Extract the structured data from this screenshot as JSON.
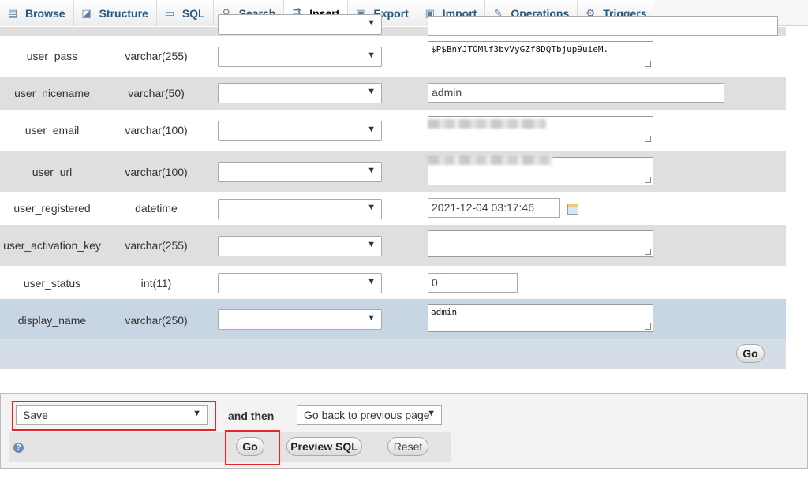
{
  "tabs": [
    {
      "label": "Browse",
      "icon": "browse-icon"
    },
    {
      "label": "Structure",
      "icon": "structure-icon"
    },
    {
      "label": "SQL",
      "icon": "sql-icon"
    },
    {
      "label": "Search",
      "icon": "search-icon"
    },
    {
      "label": "Insert",
      "icon": "insert-icon",
      "active": true
    },
    {
      "label": "Export",
      "icon": "export-icon"
    },
    {
      "label": "Import",
      "icon": "import-icon"
    },
    {
      "label": "Operations",
      "icon": "wrench-icon"
    },
    {
      "label": "Triggers",
      "icon": "triggers-icon"
    }
  ],
  "rows": [
    {
      "name": "user_pass",
      "type": "varchar(255)",
      "value": "$P$BnYJTOMlf3bvVyGZf8DQTbjup9uieM."
    },
    {
      "name": "user_nicename",
      "type": "varchar(50)",
      "value": "admin"
    },
    {
      "name": "user_email",
      "type": "varchar(100)",
      "value": ""
    },
    {
      "name": "user_url",
      "type": "varchar(100)",
      "value": ""
    },
    {
      "name": "user_registered",
      "type": "datetime",
      "value": "2021-12-04 03:17:46"
    },
    {
      "name": "user_activation_key",
      "type": "varchar(255)",
      "value": ""
    },
    {
      "name": "user_status",
      "type": "int(11)",
      "value": "0"
    },
    {
      "name": "display_name",
      "type": "varchar(250)",
      "value": "admin"
    }
  ],
  "go_label": "Go",
  "bottom": {
    "action_select": "Save",
    "and_then_label": "and then",
    "after_select": "Go back to previous page",
    "go_label": "Go",
    "preview_label": "Preview SQL",
    "reset_label": "Reset"
  },
  "colors": {
    "highlight": "#e0272b",
    "tab_text": "#235a81"
  }
}
